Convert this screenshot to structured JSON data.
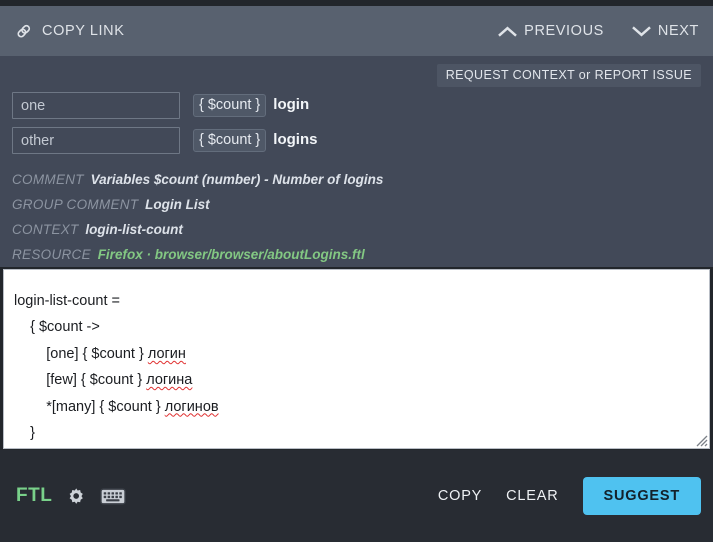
{
  "header": {
    "copy_link": {
      "label": "COPY LINK",
      "icon": "link-icon"
    },
    "previous": {
      "label": "PREVIOUS",
      "icon": "chevron-up-icon"
    },
    "next": {
      "label": "NEXT",
      "icon": "chevron-down-icon"
    }
  },
  "body": {
    "context_pill": "REQUEST CONTEXT or REPORT ISSUE",
    "plurals": [
      {
        "key": "one",
        "placeholder": "{ $count }",
        "text": "login"
      },
      {
        "key": "other",
        "placeholder": "{ $count }",
        "text": "logins"
      }
    ],
    "meta": [
      {
        "label": "COMMENT",
        "value": "Variables $count (number) - Number of logins",
        "color": "default"
      },
      {
        "label": "GROUP COMMENT",
        "value": "Login List",
        "color": "default"
      },
      {
        "label": "CONTEXT",
        "value": "login-list-count",
        "color": "default"
      },
      {
        "label": "RESOURCE",
        "value": "Firefox · browser/browser/aboutLogins.ftl",
        "color": "green"
      }
    ]
  },
  "editor": {
    "lines": [
      {
        "indent": 0,
        "parts": [
          {
            "text": "login-list-count =",
            "misspelled": false
          }
        ]
      },
      {
        "indent": 1,
        "parts": [
          {
            "text": "{ $count ->",
            "misspelled": false
          }
        ]
      },
      {
        "indent": 2,
        "parts": [
          {
            "text": "[one] { $count } ",
            "misspelled": false
          },
          {
            "text": "логин",
            "misspelled": true
          }
        ]
      },
      {
        "indent": 2,
        "parts": [
          {
            "text": "[few] { $count } ",
            "misspelled": false
          },
          {
            "text": "логина",
            "misspelled": true
          }
        ]
      },
      {
        "indent": 2,
        "parts": [
          {
            "text": "*[many] { $count } ",
            "misspelled": false
          },
          {
            "text": "логинов",
            "misspelled": true
          }
        ]
      },
      {
        "indent": 1,
        "parts": [
          {
            "text": "}",
            "misspelled": false
          }
        ]
      }
    ]
  },
  "footer": {
    "format_label": "FTL",
    "settings_icon": "gear-icon",
    "keyboard_icon": "keyboard-icon",
    "copy_label": "COPY",
    "clear_label": "CLEAR",
    "suggest_label": "SUGGEST"
  },
  "colors": {
    "header_bg": "#58616f",
    "body_bg": "#424958",
    "footer_bg": "#282c33",
    "accent_blue": "#4fc2f0",
    "accent_green": "#79d18a",
    "resource_green": "#83c883",
    "spell_error": "#e03030"
  }
}
